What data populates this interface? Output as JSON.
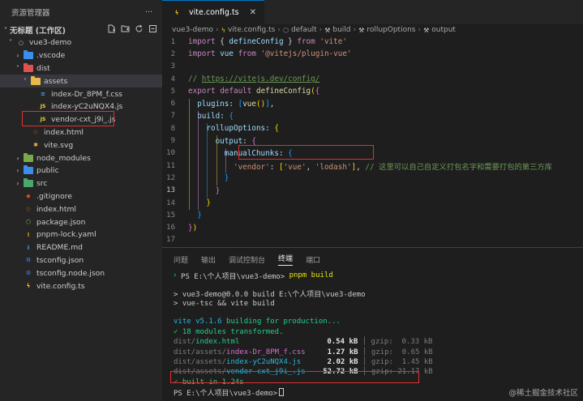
{
  "sidebar": {
    "header": "资源管理器",
    "more": "···",
    "section": "无标题 (工作区)",
    "actions": [
      "new-file",
      "new-folder",
      "refresh",
      "collapse"
    ]
  },
  "tree": [
    {
      "name": "vue3-demo",
      "depth": 0,
      "chev": "˅",
      "icon": "root"
    },
    {
      "name": ".vscode",
      "depth": 1,
      "chev": "›",
      "icon": "folder-vscode"
    },
    {
      "name": "dist",
      "depth": 1,
      "chev": "˅",
      "icon": "folder-dist"
    },
    {
      "name": "assets",
      "depth": 2,
      "chev": "˅",
      "icon": "folder-assets",
      "active": true
    },
    {
      "name": "index-Dr_8PM_f.css",
      "depth": 3,
      "icon": "css"
    },
    {
      "name": "index-yC2uNQX4.js",
      "depth": 3,
      "icon": "js"
    },
    {
      "name": "vendor-cxt_j9i_.js",
      "depth": 3,
      "icon": "js"
    },
    {
      "name": "index.html",
      "depth": 2,
      "icon": "html"
    },
    {
      "name": "vite.svg",
      "depth": 2,
      "icon": "svg"
    },
    {
      "name": "node_modules",
      "depth": 1,
      "chev": "›",
      "icon": "folder-node"
    },
    {
      "name": "public",
      "depth": 1,
      "chev": "›",
      "icon": "folder-public"
    },
    {
      "name": "src",
      "depth": 1,
      "chev": "›",
      "icon": "folder-src"
    },
    {
      "name": ".gitignore",
      "depth": 1,
      "icon": "git"
    },
    {
      "name": "index.html",
      "depth": 1,
      "icon": "html"
    },
    {
      "name": "package.json",
      "depth": 1,
      "icon": "npm"
    },
    {
      "name": "pnpm-lock.yaml",
      "depth": 1,
      "icon": "yaml"
    },
    {
      "name": "README.md",
      "depth": 1,
      "icon": "info"
    },
    {
      "name": "tsconfig.json",
      "depth": 1,
      "icon": "ts"
    },
    {
      "name": "tsconfig.node.json",
      "depth": 1,
      "icon": "ts"
    },
    {
      "name": "vite.config.ts",
      "depth": 1,
      "icon": "vite"
    }
  ],
  "editor": {
    "tab": "vite.config.ts",
    "tab_close": "✕",
    "breadcrumbs": [
      "vue3-demo",
      "vite.config.ts",
      "default",
      "build",
      "rollupOptions",
      "output"
    ],
    "current_line": 13,
    "lines": [
      [
        [
          "import ",
          "kw"
        ],
        [
          "{ ",
          "t"
        ],
        [
          "defineConfig",
          "var"
        ],
        [
          " } ",
          "t"
        ],
        [
          "from ",
          "kw"
        ],
        [
          "'vite'",
          "str"
        ]
      ],
      [
        [
          "import ",
          "kw"
        ],
        [
          "vue ",
          "var"
        ],
        [
          "from ",
          "kw"
        ],
        [
          "'@vitejs/plugin-vue'",
          "str"
        ]
      ],
      [],
      [
        [
          "// ",
          "cm"
        ],
        [
          "https://vitejs.dev/config/",
          "cmu"
        ]
      ],
      [
        [
          "export ",
          "kw"
        ],
        [
          "default ",
          "kw"
        ],
        [
          "defineConfig",
          "fn"
        ],
        [
          "(",
          "br1"
        ],
        [
          "{",
          "br2"
        ]
      ],
      [
        [
          "  plugins",
          "var"
        ],
        [
          ": ",
          "t"
        ],
        [
          "[",
          "br3"
        ],
        [
          "vue",
          "fn"
        ],
        [
          "()",
          "br1"
        ],
        [
          "]",
          "br3"
        ],
        [
          ",",
          "t"
        ]
      ],
      [
        [
          "  build",
          "var"
        ],
        [
          ": ",
          "t"
        ],
        [
          "{",
          "br3"
        ]
      ],
      [
        [
          "    rollupOptions",
          "var"
        ],
        [
          ": ",
          "t"
        ],
        [
          "{",
          "br1"
        ]
      ],
      [
        [
          "      output",
          "var"
        ],
        [
          ": ",
          "t"
        ],
        [
          "{",
          "br2"
        ]
      ],
      [
        [
          "        manualChunks",
          "var"
        ],
        [
          ": ",
          "t"
        ],
        [
          "{",
          "br3"
        ]
      ],
      [
        [
          "          'vendor'",
          "str"
        ],
        [
          ": ",
          "t"
        ],
        [
          "[",
          "br1"
        ],
        [
          "'vue'",
          "str"
        ],
        [
          ", ",
          "t"
        ],
        [
          "'lodash'",
          "str"
        ],
        [
          "]",
          "br1"
        ],
        [
          ", ",
          "t"
        ],
        [
          "// 这里可以自己自定义打包名字和需要打包的第三方库",
          "cm"
        ]
      ],
      [
        [
          "        }",
          "br3"
        ]
      ],
      [
        [
          "      }",
          "br2"
        ]
      ],
      [
        [
          "    }",
          "br1"
        ]
      ],
      [
        [
          "  }",
          "br3"
        ]
      ],
      [
        [
          "}",
          "br2"
        ],
        [
          ")",
          "br1"
        ]
      ],
      []
    ]
  },
  "panel": {
    "tabs": [
      "问题",
      "输出",
      "调试控制台",
      "终端",
      "端口"
    ],
    "active_tab": 3,
    "prompt1": "PS E:\\个人项目\\vue3-demo>",
    "command": " pnpm build",
    "out1": "> vue3-demo@0.0.0 build E:\\个人项目\\vue3-demo",
    "out2": "> vue-tsc && vite build",
    "vite_ver": "vite v5.1.6",
    "building": " building for production...",
    "transformed": "✓ 18 modules transformed.",
    "files": [
      {
        "dir": "dist/",
        "name": "index.html",
        "size": "0.54 kB",
        "gzip": "gzip:  0.33 kB",
        "color": "green"
      },
      {
        "dir": "dist/assets/",
        "name": "index-Dr_8PM_f.css",
        "size": "1.27 kB",
        "gzip": "gzip:  0.65 kB",
        "color": "purple"
      },
      {
        "dir": "dist/assets/",
        "name": "index-yC2uNQX4.js",
        "size": "2.02 kB",
        "gzip": "gzip:  1.45 kB",
        "color": "cyan"
      },
      {
        "dir": "dist/assets/",
        "name": "vendor-cxt_j9i_.js",
        "size": "52.72 kB",
        "gzip": "gzip: 21.17 kB",
        "color": "cyan"
      }
    ],
    "built": "✓ built in 1.24s",
    "prompt2": "PS E:\\个人项目\\vue3-demo>"
  },
  "watermark": "@稀土掘金技术社区"
}
